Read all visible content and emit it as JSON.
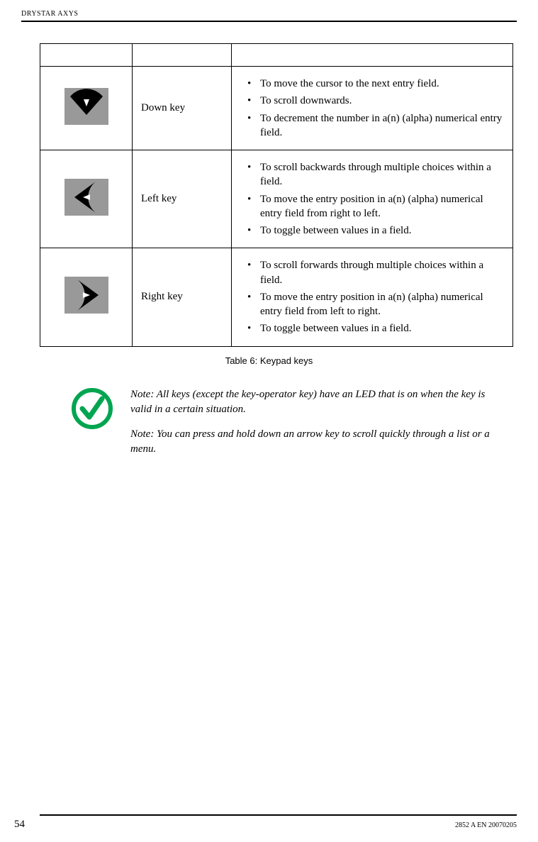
{
  "header": {
    "title": "DRYSTAR AXYS"
  },
  "table": {
    "rows": [
      {
        "name": "Down  key",
        "direction": "down",
        "items": [
          "To move the cursor to the next entry field.",
          "To scroll downwards.",
          "To decrement the number in a(n) (alpha) numerical entry field."
        ]
      },
      {
        "name": "Left  key",
        "direction": "left",
        "items": [
          "To scroll backwards through multiple choices within a field.",
          "To move the entry position in a(n) (alpha) numerical entry field from right to left.",
          "To toggle between values in a field."
        ]
      },
      {
        "name": "Right  key",
        "direction": "right",
        "items": [
          "To scroll forwards through multiple choices within a field.",
          "To move the entry position in a(n) (alpha) numerical entry field from left to right.",
          "To toggle between values in a field."
        ]
      }
    ],
    "caption": "Table 6: Keypad keys"
  },
  "notes": {
    "note1": "Note: All keys (except the key-operator key) have an LED that is on when the key is valid in a certain situation.",
    "note2": "Note: You can press and hold down an arrow key to scroll quickly through a list or a menu."
  },
  "footer": {
    "page": "54",
    "docid": "2852 A EN 20070205"
  }
}
